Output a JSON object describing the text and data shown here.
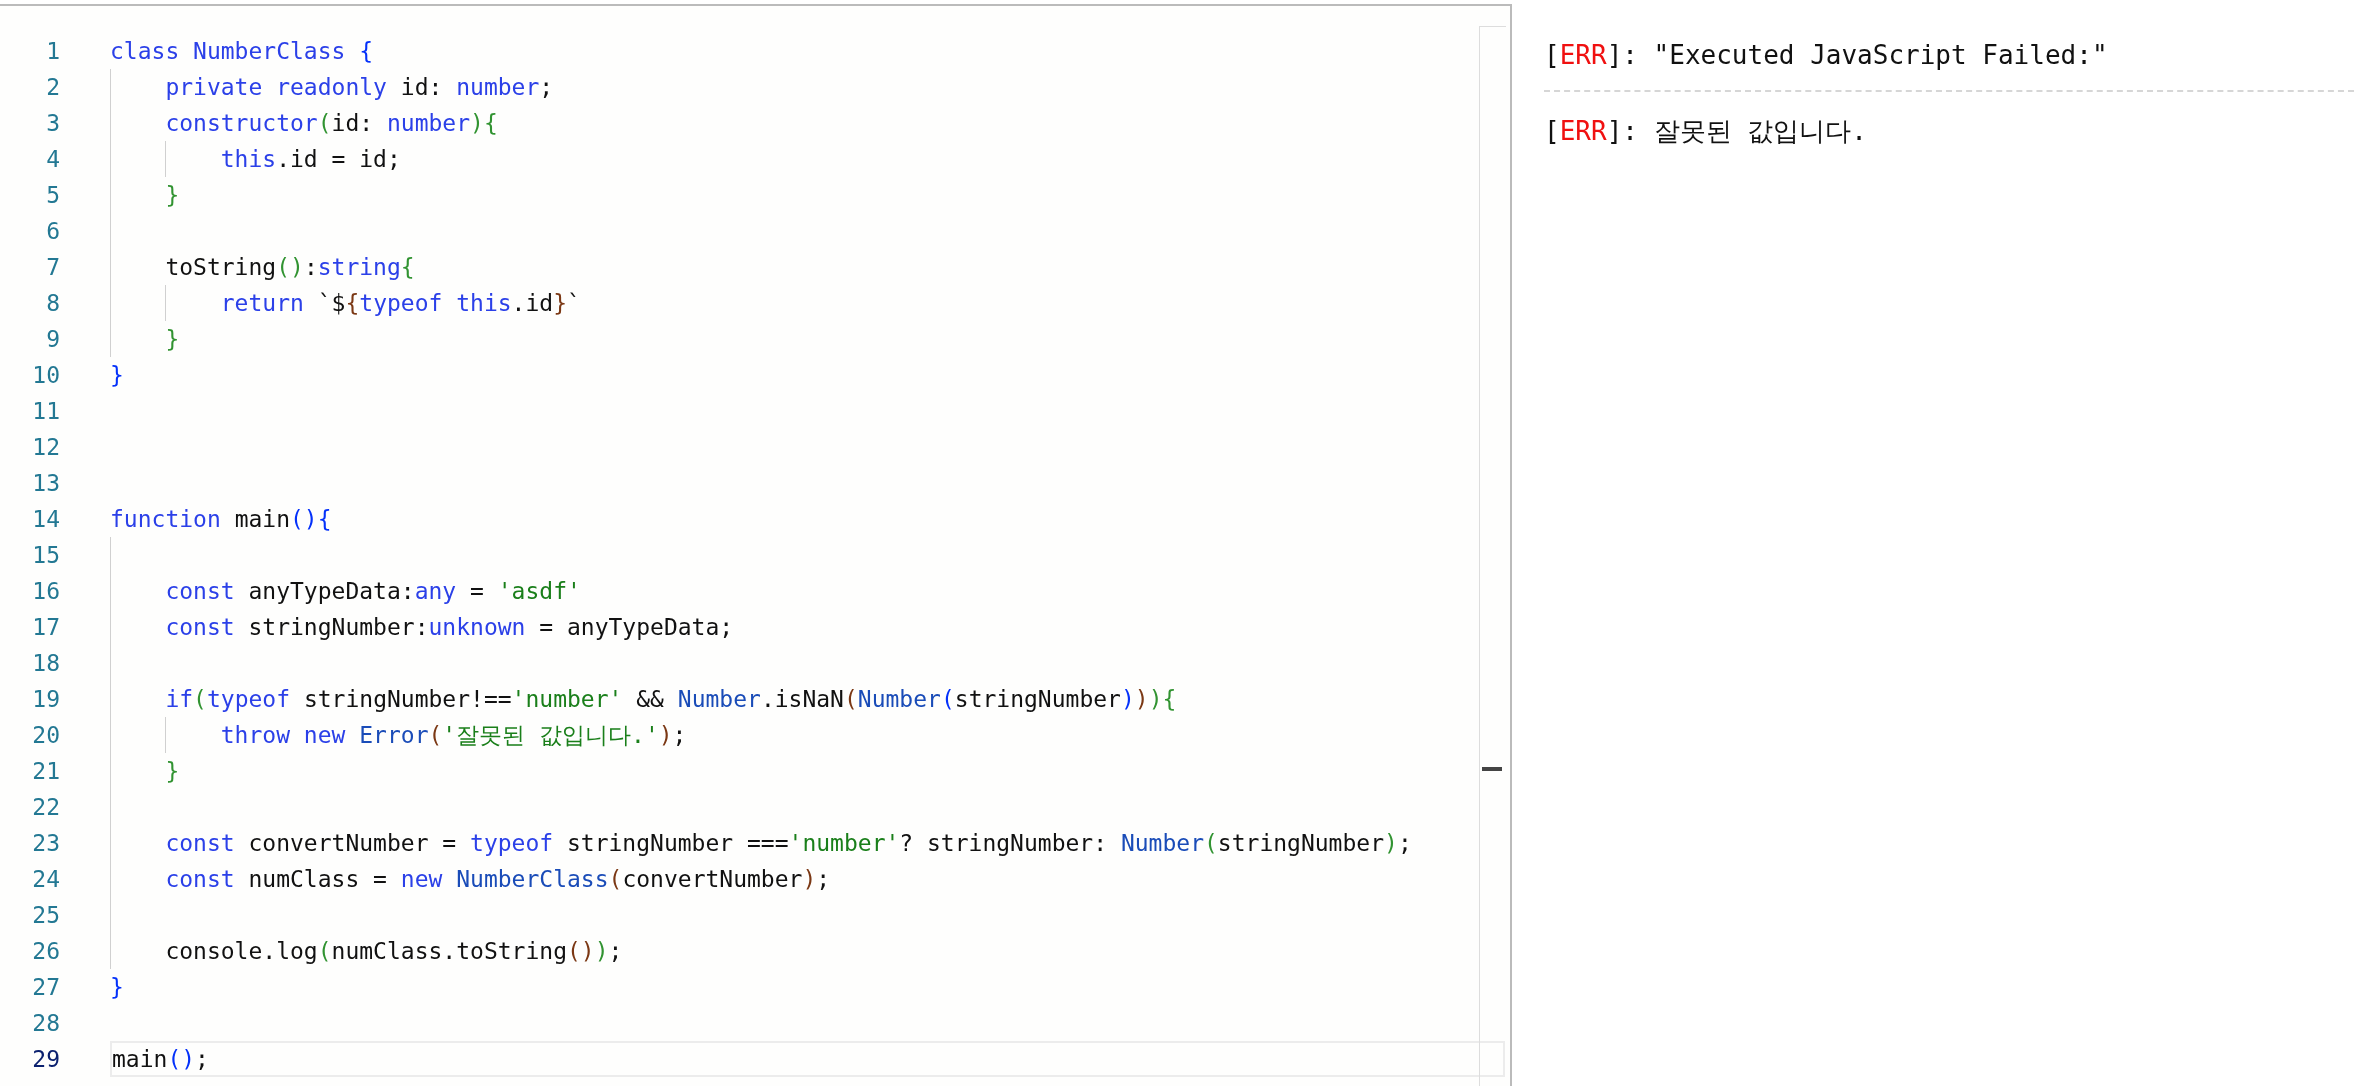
{
  "editor": {
    "lines": [
      {
        "number": "1",
        "current": false,
        "tokens": [
          {
            "t": "class NumberClass ",
            "kind": "kw"
          },
          {
            "t": "{",
            "kind": "b1"
          }
        ]
      },
      {
        "number": "2",
        "current": false,
        "tokens": [
          {
            "t": "    private readonly ",
            "kind": "kw"
          },
          {
            "t": "id: ",
            "kind": "plain"
          },
          {
            "t": "number",
            "kind": "kw"
          },
          {
            "t": ";",
            "kind": "plain"
          }
        ]
      },
      {
        "number": "3",
        "current": false,
        "tokens": [
          {
            "t": "    constructor",
            "kind": "kw"
          },
          {
            "t": "(",
            "kind": "b2"
          },
          {
            "t": "id: ",
            "kind": "plain"
          },
          {
            "t": "number",
            "kind": "kw"
          },
          {
            "t": "){",
            "kind": "b2"
          }
        ]
      },
      {
        "number": "4",
        "current": false,
        "tokens": [
          {
            "t": "        this",
            "kind": "kw"
          },
          {
            "t": ".id = id;",
            "kind": "plain"
          }
        ]
      },
      {
        "number": "5",
        "current": false,
        "tokens": [
          {
            "t": "    }",
            "kind": "b2"
          }
        ]
      },
      {
        "number": "6",
        "current": false
      },
      {
        "number": "7",
        "current": false,
        "tokens": [
          {
            "t": "    toString",
            "kind": "plain"
          },
          {
            "t": "()",
            "kind": "b2"
          },
          {
            "t": ":",
            "kind": "plain"
          },
          {
            "t": "string",
            "kind": "kw"
          },
          {
            "t": "{",
            "kind": "b2"
          }
        ]
      },
      {
        "number": "8",
        "current": false,
        "tokens": [
          {
            "t": "        return ",
            "kind": "kw"
          },
          {
            "t": "`$",
            "kind": "plain"
          },
          {
            "t": "{",
            "kind": "b3"
          },
          {
            "t": "typeof this",
            "kind": "kw"
          },
          {
            "t": ".id",
            "kind": "plain"
          },
          {
            "t": "}",
            "kind": "b3"
          },
          {
            "t": "`",
            "kind": "plain"
          }
        ]
      },
      {
        "number": "9",
        "current": false,
        "tokens": [
          {
            "t": "    }",
            "kind": "b2"
          }
        ]
      },
      {
        "number": "10",
        "current": false,
        "tokens": [
          {
            "t": "}",
            "kind": "b1"
          }
        ]
      },
      {
        "number": "11",
        "current": false
      },
      {
        "number": "12",
        "current": false
      },
      {
        "number": "13",
        "current": false
      },
      {
        "number": "14",
        "current": false,
        "tokens": [
          {
            "t": "function ",
            "kind": "kw"
          },
          {
            "t": "main",
            "kind": "plain"
          },
          {
            "t": "(){",
            "kind": "b1"
          }
        ]
      },
      {
        "number": "15",
        "current": false
      },
      {
        "number": "16",
        "current": false,
        "tokens": [
          {
            "t": "    const ",
            "kind": "kw"
          },
          {
            "t": "anyTypeData:",
            "kind": "plain"
          },
          {
            "t": "any",
            "kind": "kw"
          },
          {
            "t": " = ",
            "kind": "plain"
          },
          {
            "t": "'asdf'",
            "kind": "str"
          }
        ]
      },
      {
        "number": "17",
        "current": false,
        "tokens": [
          {
            "t": "    const ",
            "kind": "kw"
          },
          {
            "t": "stringNumber:",
            "kind": "plain"
          },
          {
            "t": "unknown",
            "kind": "kw"
          },
          {
            "t": " = anyTypeData;",
            "kind": "plain"
          }
        ]
      },
      {
        "number": "18",
        "current": false
      },
      {
        "number": "19",
        "current": false,
        "tokens": [
          {
            "t": "    if",
            "kind": "kw"
          },
          {
            "t": "(",
            "kind": "b2"
          },
          {
            "t": "typeof ",
            "kind": "kw"
          },
          {
            "t": "stringNumber!==",
            "kind": "plain"
          },
          {
            "t": "'number'",
            "kind": "str"
          },
          {
            "t": " && ",
            "kind": "plain"
          },
          {
            "t": "Number",
            "kind": "type"
          },
          {
            "t": ".isNaN",
            "kind": "plain"
          },
          {
            "t": "(",
            "kind": "b3"
          },
          {
            "t": "Number",
            "kind": "type"
          },
          {
            "t": "(",
            "kind": "b1"
          },
          {
            "t": "stringNumber",
            "kind": "plain"
          },
          {
            "t": ")",
            "kind": "b1"
          },
          {
            "t": ")",
            "kind": "b3"
          },
          {
            "t": "){",
            "kind": "b2"
          }
        ]
      },
      {
        "number": "20",
        "current": false,
        "tokens": [
          {
            "t": "        throw new ",
            "kind": "kw"
          },
          {
            "t": "Error",
            "kind": "type"
          },
          {
            "t": "(",
            "kind": "b3"
          },
          {
            "t": "'잘못된 값입니다.'",
            "kind": "str"
          },
          {
            "t": ")",
            "kind": "b3"
          },
          {
            "t": ";",
            "kind": "plain"
          }
        ]
      },
      {
        "number": "21",
        "current": false,
        "tokens": [
          {
            "t": "    }",
            "kind": "b2"
          }
        ]
      },
      {
        "number": "22",
        "current": false
      },
      {
        "number": "23",
        "current": false,
        "tokens": [
          {
            "t": "    const ",
            "kind": "kw"
          },
          {
            "t": "convertNumber = ",
            "kind": "plain"
          },
          {
            "t": "typeof ",
            "kind": "kw"
          },
          {
            "t": "stringNumber ===",
            "kind": "plain"
          },
          {
            "t": "'number'",
            "kind": "str"
          },
          {
            "t": "? stringNumber: ",
            "kind": "plain"
          },
          {
            "t": "Number",
            "kind": "type"
          },
          {
            "t": "(",
            "kind": "b2"
          },
          {
            "t": "stringNumber",
            "kind": "plain"
          },
          {
            "t": ")",
            "kind": "b2"
          },
          {
            "t": ";",
            "kind": "plain"
          }
        ]
      },
      {
        "number": "24",
        "current": false,
        "tokens": [
          {
            "t": "    const ",
            "kind": "kw"
          },
          {
            "t": "numClass = ",
            "kind": "plain"
          },
          {
            "t": "new ",
            "kind": "kw"
          },
          {
            "t": "NumberClass",
            "kind": "type"
          },
          {
            "t": "(",
            "kind": "b3"
          },
          {
            "t": "convertNumber",
            "kind": "plain"
          },
          {
            "t": ")",
            "kind": "b3"
          },
          {
            "t": ";",
            "kind": "plain"
          }
        ]
      },
      {
        "number": "25",
        "current": false
      },
      {
        "number": "26",
        "current": false,
        "tokens": [
          {
            "t": "    console.log",
            "kind": "plain"
          },
          {
            "t": "(",
            "kind": "b2"
          },
          {
            "t": "numClass.toString",
            "kind": "plain"
          },
          {
            "t": "()",
            "kind": "b3"
          },
          {
            "t": ")",
            "kind": "b2"
          },
          {
            "t": ";",
            "kind": "plain"
          }
        ]
      },
      {
        "number": "27",
        "current": false,
        "tokens": [
          {
            "t": "}",
            "kind": "b1"
          }
        ]
      },
      {
        "number": "28",
        "current": false
      },
      {
        "number": "29",
        "current": true,
        "tokens": [
          {
            "t": "main",
            "kind": "plain"
          },
          {
            "t": "()",
            "kind": "b1"
          },
          {
            "t": ";",
            "kind": "plain"
          }
        ]
      }
    ]
  },
  "console": {
    "entries": [
      {
        "kind": "error",
        "open": "[",
        "tag": "ERR",
        "close": "]:",
        "message": "\"Executed JavaScript Failed:\""
      },
      {
        "kind": "error",
        "open": "[",
        "tag": "ERR",
        "close": "]:",
        "message": "잘못된 값입니다."
      }
    ]
  }
}
